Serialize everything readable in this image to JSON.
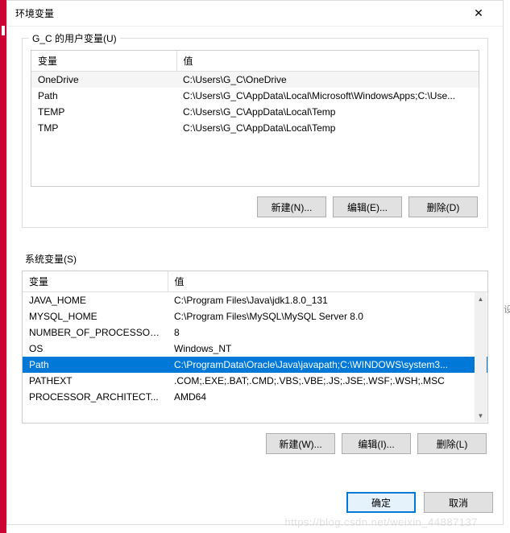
{
  "titlebar": {
    "title": "环境变量"
  },
  "userSection": {
    "label": "G_C 的用户变量(U)",
    "headers": {
      "var": "变量",
      "val": "值"
    },
    "rows": [
      {
        "var": "OneDrive",
        "val": "C:\\Users\\G_C\\OneDrive"
      },
      {
        "var": "Path",
        "val": "C:\\Users\\G_C\\AppData\\Local\\Microsoft\\WindowsApps;C:\\Use..."
      },
      {
        "var": "TEMP",
        "val": "C:\\Users\\G_C\\AppData\\Local\\Temp"
      },
      {
        "var": "TMP",
        "val": "C:\\Users\\G_C\\AppData\\Local\\Temp"
      }
    ],
    "buttons": {
      "new": "新建(N)...",
      "edit": "编辑(E)...",
      "delete": "删除(D)"
    }
  },
  "systemSection": {
    "label": "系统变量(S)",
    "headers": {
      "var": "变量",
      "val": "值"
    },
    "rows": [
      {
        "var": "JAVA_HOME",
        "val": "C:\\Program Files\\Java\\jdk1.8.0_131"
      },
      {
        "var": "MYSQL_HOME",
        "val": "C:\\Program Files\\MySQL\\MySQL Server 8.0"
      },
      {
        "var": "NUMBER_OF_PROCESSORS",
        "val": "8"
      },
      {
        "var": "OS",
        "val": "Windows_NT"
      },
      {
        "var": "Path",
        "val": "C:\\ProgramData\\Oracle\\Java\\javapath;C:\\WINDOWS\\system3..."
      },
      {
        "var": "PATHEXT",
        "val": ".COM;.EXE;.BAT;.CMD;.VBS;.VBE;.JS;.JSE;.WSF;.WSH;.MSC"
      },
      {
        "var": "PROCESSOR_ARCHITECT...",
        "val": "AMD64"
      }
    ],
    "selectedIndex": 4,
    "buttons": {
      "new": "新建(W)...",
      "edit": "编辑(I)...",
      "delete": "删除(L)"
    }
  },
  "mainButtons": {
    "ok": "确定",
    "cancel": "取消"
  },
  "watermark": "https://blog.csdn.net/weixin_44887137"
}
